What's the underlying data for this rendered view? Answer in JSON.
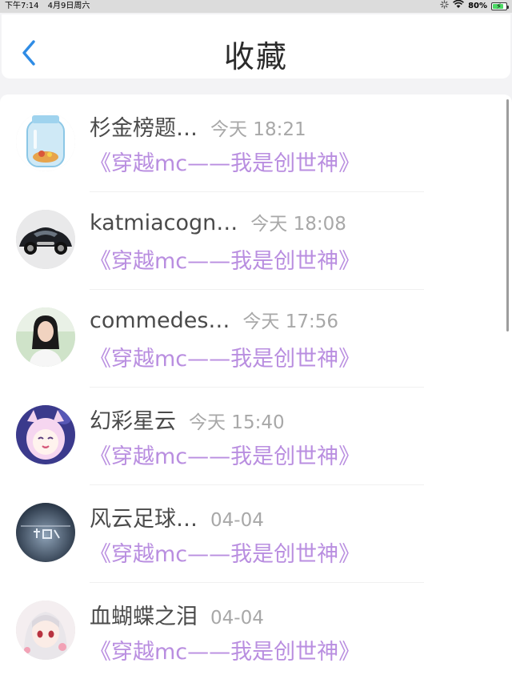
{
  "status_bar": {
    "time": "下午7:14",
    "date": "4月9日周六",
    "battery_text": "80%",
    "battery_level": 0.8
  },
  "header": {
    "title": "收藏",
    "back_icon": "chevron-left-icon"
  },
  "list": {
    "items": [
      {
        "name": "杉金榜题…",
        "time": "今天 18:21",
        "title": "《穿越mc——我是创世神》",
        "avatar": "jar-avatar"
      },
      {
        "name": "katmiacogn…",
        "time": "今天 18:08",
        "title": "《穿越mc——我是创世神》",
        "avatar": "car-avatar"
      },
      {
        "name": "commedes…",
        "time": "今天 17:56",
        "title": "《穿越mc——我是创世神》",
        "avatar": "portrait-avatar"
      },
      {
        "name": "幻彩星云",
        "time": "今天 15:40",
        "title": "《穿越mc——我是创世神》",
        "avatar": "anime-avatar"
      },
      {
        "name": "风云足球…",
        "time": "04-04",
        "title": "《穿越mc——我是创世神》",
        "avatar": "logo-avatar"
      },
      {
        "name": "血蝴蝶之泪",
        "time": "04-04",
        "title": "《穿越mc——我是创世神》",
        "avatar": "anime-girl-avatar"
      }
    ]
  },
  "colors": {
    "accent_blue": "#2f8ce5",
    "title_purple": "#b98ee0",
    "name_gray": "#4a4a4a",
    "time_gray": "#a8a8a8"
  }
}
